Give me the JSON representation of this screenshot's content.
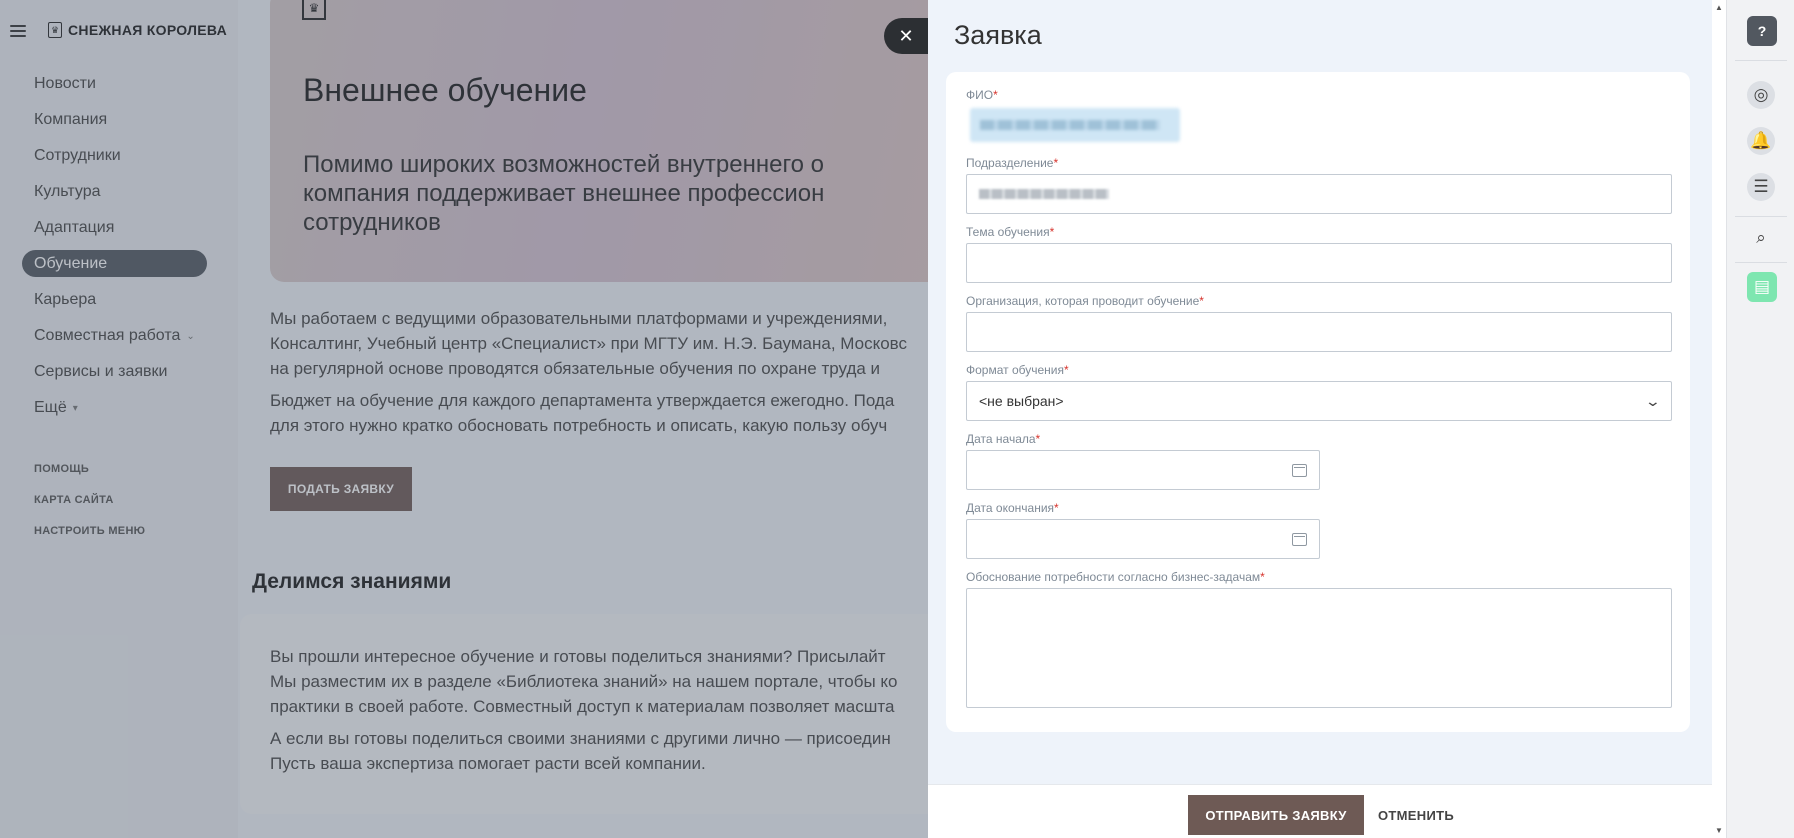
{
  "sidebar": {
    "brand": "СНЕЖНАЯ КОРОЛЕВА",
    "items": [
      {
        "label": "Новости"
      },
      {
        "label": "Компания"
      },
      {
        "label": "Сотрудники"
      },
      {
        "label": "Культура"
      },
      {
        "label": "Адаптация"
      },
      {
        "label": "Обучение",
        "active": true
      },
      {
        "label": "Карьера"
      },
      {
        "label": "Совместная работа"
      },
      {
        "label": "Сервисы и заявки"
      },
      {
        "label": "Ещё"
      }
    ],
    "subitems": [
      {
        "label": "ПОМОЩЬ"
      },
      {
        "label": "КАРТА САЙТА"
      },
      {
        "label": "НАСТРОИТЬ МЕНЮ"
      }
    ]
  },
  "main": {
    "hero_title": "Внешнее обучение",
    "hero_sub_1": "Помимо широких возможностей внутреннего о",
    "hero_sub_2": "компания поддерживает внешнее профессион",
    "hero_sub_3": "сотрудников",
    "para1_1": "Мы работаем с ведущими образовательными платформами и учреждениями,",
    "para1_2": "Консалтинг, Учебный центр «Специалист» при МГТУ им. Н.Э. Баумана, Московс",
    "para1_3": "на регулярной основе проводятся обязательные обучения по охране труда и",
    "para2_1": "Бюджет на обучение для каждого департамента утверждается ежегодно. Пода",
    "para2_2": "для этого нужно кратко обосновать потребность и описать, какую пользу обуч",
    "apply_button": "ПОДАТЬ ЗАЯВКУ",
    "section_title": "Делимся знаниями",
    "para3_1": "Вы прошли интересное обучение и готовы поделиться знаниями? Присылайт",
    "para3_2": "Мы разместим их в разделе «Библиотека знаний» на нашем портале, чтобы ко",
    "para3_3": "практики в своей работе. Совместный доступ к материалам позволяет масшта",
    "para4_1": "А если вы готовы поделиться своими знаниями с другими лично — присоедин",
    "para4_2": "Пусть ваша экспертиза помогает расти всей компании."
  },
  "panel": {
    "title": "Заявка",
    "required_mark": "*",
    "fields": {
      "fio": {
        "label": "ФИО"
      },
      "department": {
        "label": "Подразделение"
      },
      "topic": {
        "label": "Тема обучения",
        "value": ""
      },
      "organization": {
        "label": "Организация, которая проводит обучение",
        "value": ""
      },
      "format": {
        "label": "Формат обучения",
        "value": "<не выбран>"
      },
      "start_date": {
        "label": "Дата начала",
        "value": ""
      },
      "end_date": {
        "label": "Дата окончания",
        "value": ""
      },
      "justification": {
        "label": "Обоснование потребности согласно бизнес-задачам",
        "value": ""
      }
    },
    "submit_button": "ОТПРАВИТЬ ЗАЯВКУ",
    "cancel_button": "ОТМЕНИТЬ"
  },
  "icons": {
    "close": "close-icon",
    "help": "help-icon",
    "rail": [
      "copilot-icon",
      "bell-icon",
      "chat-icon",
      "search-icon",
      "notes-icon"
    ]
  },
  "colors": {
    "accent_button": "#6e5a55",
    "active_nav": "#525860",
    "required": "#d6332c",
    "notes_green": "#7ee6b0"
  }
}
